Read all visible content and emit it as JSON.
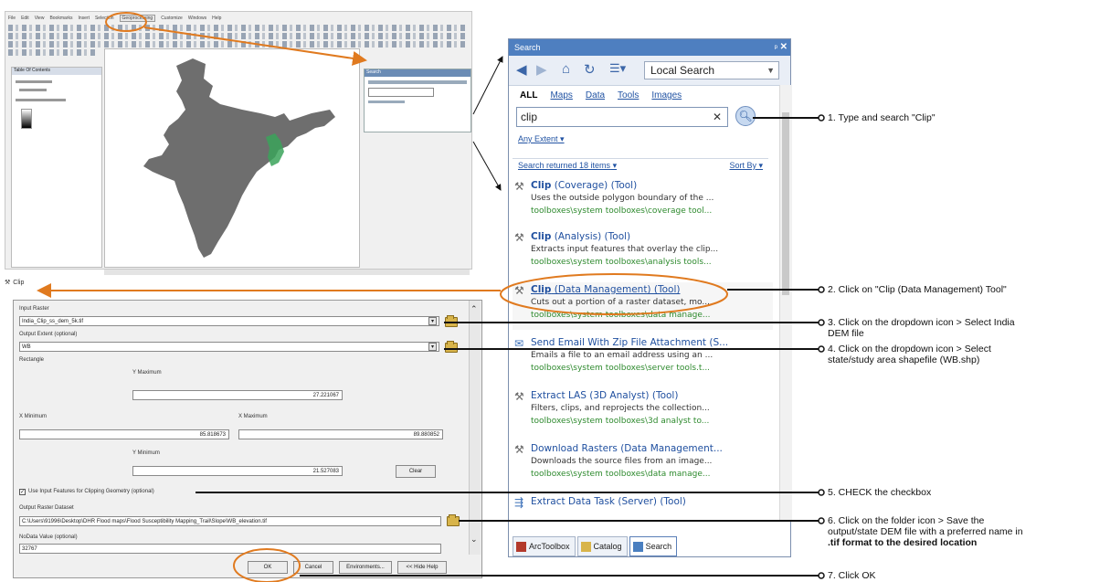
{
  "arcmap": {
    "menu": [
      "File",
      "Edit",
      "View",
      "Bookmarks",
      "Insert",
      "Selection",
      "Geoprocessing",
      "Customize",
      "Windows",
      "Help"
    ],
    "toc_header": "Table Of Contents",
    "search_mini_title": "Search"
  },
  "clip_tab": {
    "label": "Clip"
  },
  "clip_dialog": {
    "input_raster_label": "Input Raster",
    "input_raster_value": "India_Clip_ss_dem_5k.tif",
    "output_extent_label": "Output Extent (optional)",
    "output_extent_value": "WB",
    "rectangle_label": "Rectangle",
    "ymax_label": "Y Maximum",
    "ymax_value": "27.221067",
    "xmin_label": "X Minimum",
    "xmin_value": "85.818673",
    "xmax_label": "X Maximum",
    "xmax_value": "89.880852",
    "ymin_label": "Y Minimum",
    "ymin_value": "21.527083",
    "clear_label": "Clear",
    "use_input_features_label": "Use Input Features for Clipping Geometry (optional)",
    "use_input_features_checked": true,
    "output_dataset_label": "Output Raster Dataset",
    "output_dataset_value": "C:\\Users\\91996\\Desktop\\DHR Flood maps\\Flood Susceptibility Mapping_Trail\\Slope\\WB_elevation.tif",
    "nodata_label": "NoData Value (optional)",
    "nodata_value": "32767",
    "ok_label": "OK",
    "cancel_label": "Cancel",
    "env_label": "Environments...",
    "hide_help_label": "<< Hide Help"
  },
  "search_panel": {
    "title": "Search",
    "scope": "Local Search",
    "filters": {
      "all": "ALL",
      "maps": "Maps",
      "data": "Data",
      "tools": "Tools",
      "images": "Images"
    },
    "query": "clip",
    "any_extent": "Any Extent",
    "results_count": "Search returned 18 items",
    "sort_by": "Sort By",
    "results": [
      {
        "title_bold": "Clip",
        "title_rest": " (Coverage) (Tool)",
        "desc": "Uses the outside polygon boundary of the ...",
        "path": "toolboxes\\system toolboxes\\coverage tool..."
      },
      {
        "title_bold": "Clip",
        "title_rest": " (Analysis) (Tool)",
        "desc": "Extracts input features that overlay the clip...",
        "path": "toolboxes\\system toolboxes\\analysis tools..."
      },
      {
        "title_bold": "Clip",
        "title_rest": " (Data Management) (Tool)",
        "desc": "Cuts out a portion of a raster dataset, mo...",
        "path": "toolboxes\\system toolboxes\\data manage..."
      },
      {
        "title_bold": "",
        "title_rest": "Send Email With Zip File Attachment (S...",
        "desc": "Emails a file to an email address using an ...",
        "path": "toolboxes\\system toolboxes\\server tools.t..."
      },
      {
        "title_bold": "",
        "title_rest": "Extract LAS (3D Analyst) (Tool)",
        "desc": "Filters, clips, and reprojects the collection...",
        "path": "toolboxes\\system toolboxes\\3d analyst to..."
      },
      {
        "title_bold": "",
        "title_rest": "Download Rasters (Data Management...",
        "desc": "Downloads the source files from an image...",
        "path": "toolboxes\\system toolboxes\\data manage..."
      },
      {
        "title_bold": "",
        "title_rest": "Extract Data Task (Server) (Tool)",
        "desc": "",
        "path": ""
      }
    ],
    "tabs": {
      "toolbox": "ArcToolbox",
      "catalog": "Catalog",
      "search": "Search"
    }
  },
  "steps": {
    "s1": "1. Type and search \"Clip\"",
    "s2": "2. Click on \"Clip (Data Management) Tool\"",
    "s3a": "3. Click on the dropdown icon > Select India",
    "s3b": "DEM file",
    "s4a": "4. Click on the dropdown icon > Select",
    "s4b": "state/study area shapefile (WB.shp)",
    "s5": "5. CHECK the checkbox",
    "s6a": "6. Click on the folder icon > Save the",
    "s6b": "output/state DEM file with a preferred name in",
    "s6c": ".tif format to the desired location",
    "s7": "7. Click OK"
  },
  "colors": {
    "accent": "#e07a1f",
    "arrow": "#111111",
    "map_fill": "#6e6e6e",
    "highlight": "#3ba35a"
  }
}
